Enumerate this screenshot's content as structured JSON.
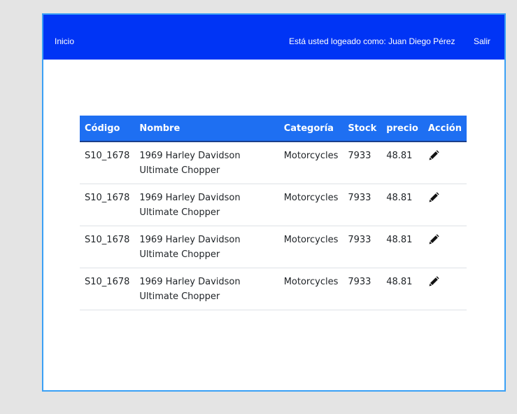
{
  "navbar": {
    "home_label": "Inicio",
    "user_label": "Está usted logeado como: Juan Diego Pérez",
    "logout_label": "Salir"
  },
  "table": {
    "headers": [
      "Código",
      "Nombre",
      "Categoría",
      "Stock",
      "precio",
      "Acción"
    ],
    "rows": [
      {
        "codigo": "S10_1678",
        "nombre": "1969 Harley Davidson Ultimate Chopper",
        "categoria": "Motorcycles",
        "stock": "7933",
        "precio": "48.81",
        "accion_icon": "pencil-icon"
      },
      {
        "codigo": "S10_1678",
        "nombre": "1969 Harley Davidson Ultimate Chopper",
        "categoria": "Motorcycles",
        "stock": "7933",
        "precio": "48.81",
        "accion_icon": "pencil-icon"
      },
      {
        "codigo": "S10_1678",
        "nombre": "1969 Harley Davidson Ultimate Chopper",
        "categoria": "Motorcycles",
        "stock": "7933",
        "precio": "48.81",
        "accion_icon": "pencil-icon"
      },
      {
        "codigo": "S10_1678",
        "nombre": "1969 Harley Davidson Ultimate Chopper",
        "categoria": "Motorcycles",
        "stock": "7933",
        "precio": "48.81",
        "accion_icon": "pencil-icon"
      }
    ]
  },
  "colors": {
    "navbar_bg": "#0034f5",
    "table_header_bg": "#1e6ff2",
    "frame_border": "#3aa0f5",
    "page_bg": "#e4e4e4"
  }
}
